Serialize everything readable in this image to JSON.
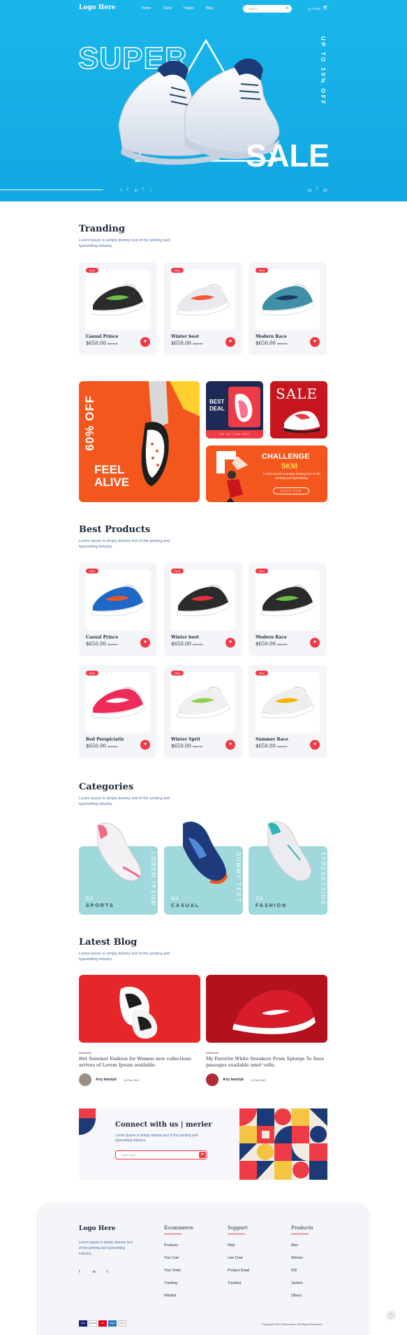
{
  "header": {
    "logo": "Logo Here",
    "nav": [
      "Home",
      "Shop",
      "Pages",
      "Blog"
    ],
    "search_placeholder": "Search",
    "cart": "(0) ITEMS"
  },
  "hero": {
    "title_outline": "SUPER",
    "title_solid": "SALE",
    "side_text": "UP TO 30% OFF",
    "social": [
      "f",
      "in",
      "t"
    ],
    "slide_current": "01",
    "slide_total": "03"
  },
  "trending": {
    "title": "Tranding",
    "subtitle": "Lorem Ipsum is simply dummy text of the printing and typesetting industry.",
    "products": [
      {
        "badge": "New",
        "name": "Casual Prince",
        "price": "$650.00",
        "old_price": "$820.00"
      },
      {
        "badge": "New",
        "name": "Winter boot",
        "price": "$650.00",
        "old_price": "$820.00"
      },
      {
        "badge": "New",
        "name": "Modern Race",
        "price": "$650.00",
        "old_price": "$820.00"
      }
    ]
  },
  "promos": {
    "big_percent": "60% OFF",
    "big_text": "FEEL ALIVE",
    "best_deal": "BEST DEAL",
    "best_deal_sub": "UP TO 15% OFF",
    "sale": "SALE",
    "challenge_title": "CHALLENGE",
    "challenge_sub": "5KM",
    "challenge_text": "Lorem Ipsum is simply dummy text of the printing and typesetting.",
    "challenge_button": "SHOP NOW"
  },
  "best": {
    "title": "Best Products",
    "subtitle": "Lorem Ipsum is simply dummy text of the printing and typesetting industry.",
    "products": [
      {
        "badge": "New",
        "name": "Casual Prince",
        "price": "$650.00",
        "old_price": "$820.00"
      },
      {
        "badge": "New",
        "name": "Winter boot",
        "price": "$650.00",
        "old_price": "$820.00"
      },
      {
        "badge": "New",
        "name": "Modern Race",
        "price": "$650.00",
        "old_price": "$820.00"
      },
      {
        "badge": "New",
        "name": "Red Perspiciatis",
        "price": "$650.00",
        "old_price": "$820.00"
      },
      {
        "badge": "New",
        "name": "Winter Sprit",
        "price": "$650.00",
        "old_price": "$820.00"
      },
      {
        "badge": "New",
        "name": "Summer Race",
        "price": "$650.00",
        "old_price": "$820.00"
      }
    ]
  },
  "categories": {
    "title": "Categories",
    "subtitle": "Lorem Ipsum is simply dummy text of the printing and typesetting industry.",
    "items": [
      {
        "code": "DX",
        "name": "SPORTS",
        "vertical": "LOREM IPSUM"
      },
      {
        "code": "RX",
        "name": "CASUAL",
        "vertical": "DUMMY TEXT"
      },
      {
        "code": "SX",
        "name": "FASHION",
        "vertical": "TYPESETTING"
      }
    ]
  },
  "blog": {
    "title": "Latest Blog",
    "subtitle": "Lorem Ipsum is simply dummy text of the printing and typesetting industry.",
    "posts": [
      {
        "tag": "FASHION",
        "title": "Hot Summer Fashion for Women new collections arrives of Lorem Ipsum available.",
        "author": "Arry Iwentyk",
        "date": "13 Feb 2021"
      },
      {
        "tag": "FASHION",
        "title": "My Favorite White Sneakers From Splurge To Save passages available amet volle.",
        "author": "Arry Iwentyk",
        "date": "13 Feb 2021"
      }
    ]
  },
  "newsletter": {
    "title": "Connect with us | merier",
    "text": "Lorem Ipsum is simply dummy text of the printing and typesetting industry.",
    "placeholder": "Enter email"
  },
  "footer": {
    "logo": "Logo Here",
    "about": "Lorem Ipsum is simply dummy text of the printing and typesetting industry.",
    "social": [
      "f",
      "in",
      "t"
    ],
    "columns": [
      {
        "title": "Ecommerce",
        "links": [
          "Products",
          "Your Cart",
          "Your Order",
          "Tracking",
          "Wishlist"
        ]
      },
      {
        "title": "Support",
        "links": [
          "Help",
          "Live Chat",
          "Product Detail",
          "Tracking"
        ]
      },
      {
        "title": "Products",
        "links": [
          "Man",
          "Women",
          "KID",
          "Jackets",
          "Others"
        ]
      }
    ],
    "payments": [
      "VISA",
      "PayPal",
      "MC",
      "AMEX",
      "Disc"
    ],
    "copyright": "Copyright 2021 Demo team. All Rights Reserved."
  },
  "colors": {
    "hero_blue": "#19b6ea",
    "accent_red": "#ef3b45",
    "promo_orange": "#f4571d",
    "category_teal": "#9fd9dc",
    "navy": "#1c2a3a"
  }
}
